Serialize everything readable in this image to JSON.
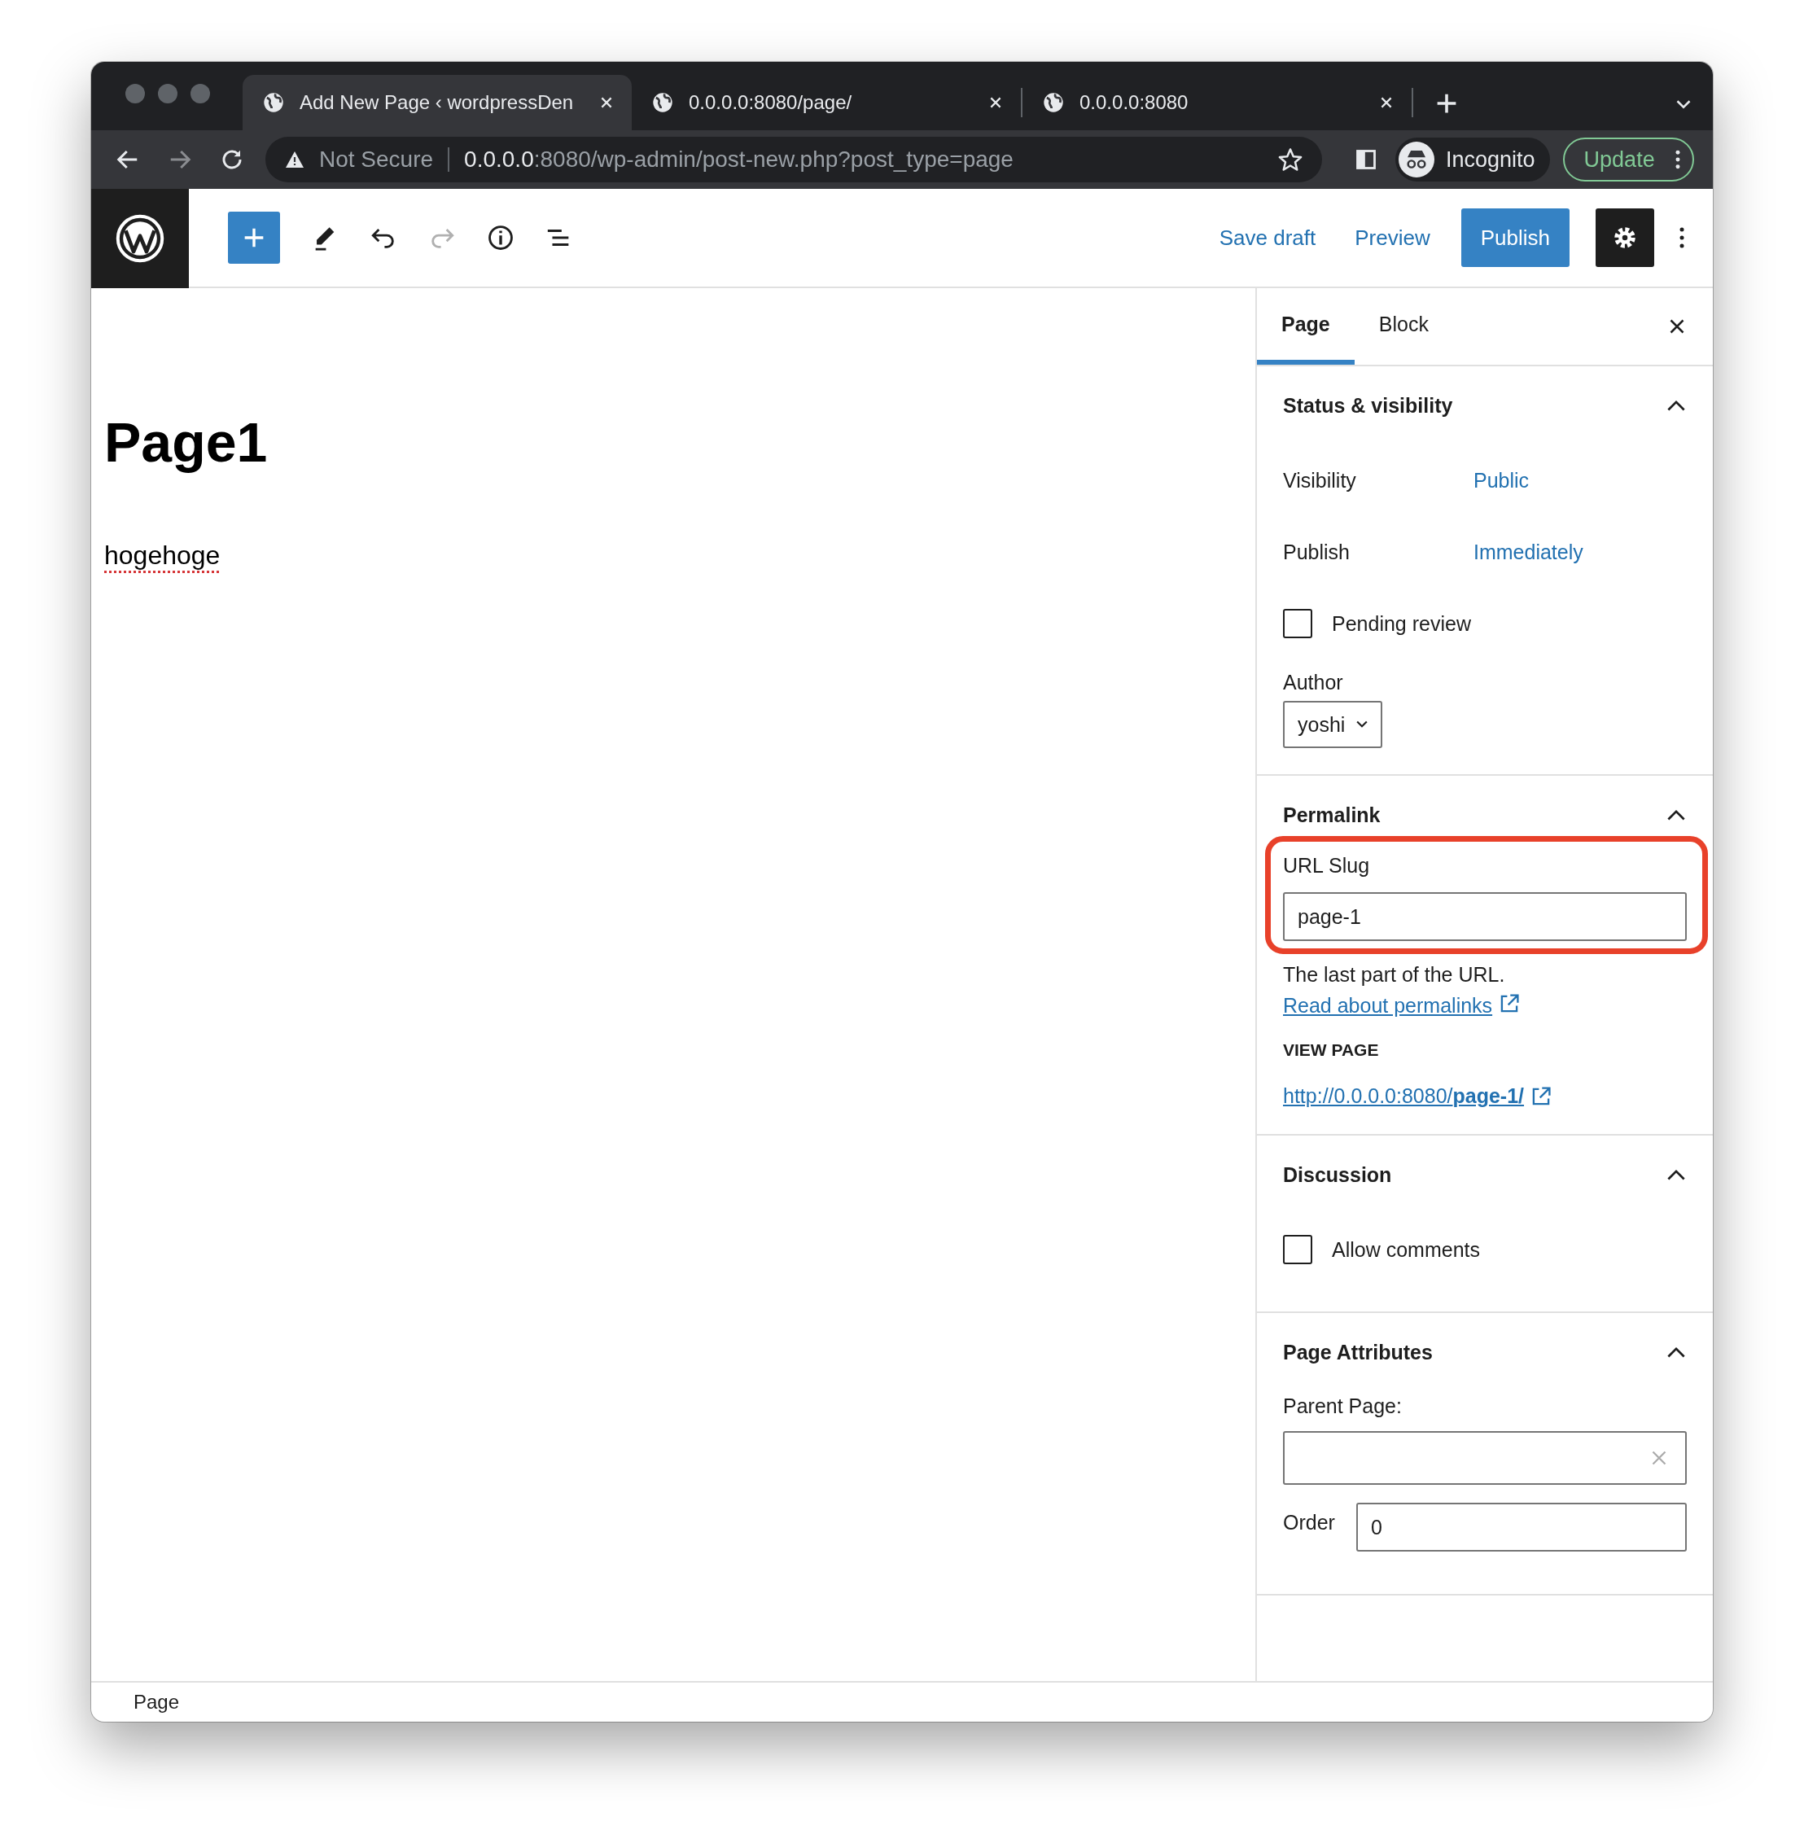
{
  "browser": {
    "tabs": [
      {
        "title": "Add New Page ‹ wordpressDen",
        "selected": true
      },
      {
        "title": "0.0.0.0:8080/page/",
        "selected": false
      },
      {
        "title": "0.0.0.0:8080",
        "selected": false
      }
    ],
    "address_bar": {
      "security": "Not Secure",
      "host": "0.0.0.0",
      "path": ":8080/wp-admin/post-new.php?post_type=page"
    },
    "profile": "Incognito",
    "update_button": "Update"
  },
  "toolbar": {
    "save_draft": "Save draft",
    "preview": "Preview",
    "publish": "Publish",
    "redo_disabled": true,
    "settings_on": true
  },
  "editor": {
    "title": "Page1",
    "paragraph": "hogehoge"
  },
  "sidebar": {
    "tabs": [
      {
        "label": "Page",
        "selected": true
      },
      {
        "label": "Block",
        "selected": false
      }
    ],
    "panels": [
      {
        "title": "Status & visibility",
        "expanded": true,
        "rows": [
          {
            "kind": "setting",
            "label": "Visibility",
            "value": "Public"
          },
          {
            "kind": "setting",
            "label": "Publish",
            "value": "Immediately"
          },
          {
            "kind": "checkbox",
            "label": "Pending review",
            "checked": false
          },
          {
            "kind": "select",
            "label": "Author",
            "value": "yoshi"
          }
        ]
      },
      {
        "title": "Permalink",
        "expanded": true,
        "rows": [
          {
            "kind": "slug",
            "label": "URL Slug",
            "value": "page-1",
            "highlighted": true
          },
          {
            "kind": "help",
            "text": "The last part of the URL.",
            "link": "Read about permalinks"
          },
          {
            "kind": "view_link",
            "label": "VIEW PAGE",
            "url": "http://0.0.0.0:8080/**page-1/**"
          }
        ]
      },
      {
        "title": "Discussion",
        "expanded": true,
        "rows": [
          {
            "kind": "checkbox",
            "label": "Allow comments",
            "checked": false
          }
        ]
      },
      {
        "title": "Page Attributes",
        "expanded": true,
        "rows": [
          {
            "kind": "combobox",
            "label": "Parent Page:"
          },
          {
            "kind": "number",
            "label": "Order",
            "value": "0"
          }
        ]
      }
    ]
  },
  "status_bar": "Page"
}
